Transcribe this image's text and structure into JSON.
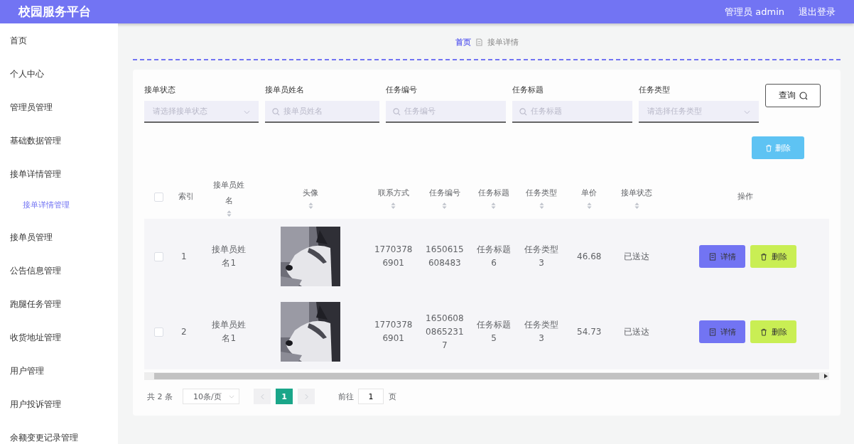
{
  "header": {
    "title": "校园服务平台",
    "user": "管理员 admin",
    "logout": "退出登录"
  },
  "sidebar": {
    "items": [
      {
        "label": "首页",
        "selected": false
      },
      {
        "label": "个人中心",
        "selected": false
      },
      {
        "label": "管理员管理",
        "selected": false
      },
      {
        "label": "基础数据管理",
        "selected": false
      },
      {
        "label": "接单详情管理",
        "selected": false,
        "children": [
          {
            "label": "接单详情管理",
            "selected": true
          }
        ]
      },
      {
        "label": "接单员管理",
        "selected": false
      },
      {
        "label": "公告信息管理",
        "selected": false
      },
      {
        "label": "跑腿任务管理",
        "selected": false
      },
      {
        "label": "收货地址管理",
        "selected": false
      },
      {
        "label": "用户管理",
        "selected": false
      },
      {
        "label": "用户投诉管理",
        "selected": false
      },
      {
        "label": "余额变更记录管理",
        "selected": false
      }
    ]
  },
  "breadcrumb": [
    {
      "label": "首页",
      "kind": "link"
    },
    {
      "label": "接单详情",
      "kind": "current"
    }
  ],
  "filters": [
    {
      "label": "接单状态",
      "kind": "select",
      "placeholder": "请选择接单状态"
    },
    {
      "label": "接单员姓名",
      "kind": "text",
      "placeholder": "接单员姓名"
    },
    {
      "label": "任务编号",
      "kind": "text",
      "placeholder": "任务编号"
    },
    {
      "label": "任务标题",
      "kind": "text",
      "placeholder": "任务标题"
    },
    {
      "label": "任务类型",
      "kind": "select",
      "placeholder": "请选择任务类型"
    }
  ],
  "query_button": "查询",
  "delete_button": "删除",
  "table": {
    "all_selected": false,
    "columns": [
      {
        "label": "索引",
        "sortable": false
      },
      {
        "label": "接单员姓名",
        "sortable": true
      },
      {
        "label": "头像",
        "sortable": true
      },
      {
        "label": "联系方式",
        "sortable": true
      },
      {
        "label": "任务编号",
        "sortable": true
      },
      {
        "label": "任务标题",
        "sortable": true
      },
      {
        "label": "任务类型",
        "sortable": true
      },
      {
        "label": "单价",
        "sortable": true
      },
      {
        "label": "接单状态",
        "sortable": true
      },
      {
        "label": "操作",
        "sortable": false
      }
    ],
    "rows": [
      {
        "selected": false,
        "cells": [
          "1",
          "接单员姓名1",
          {
            "kind": "picture"
          },
          "17703786901",
          "1650615608483",
          "任务标题6",
          "任务类型3",
          "46.68",
          "已送达"
        ],
        "actions": [
          {
            "label": "详情",
            "kind": "detail"
          },
          {
            "label": "删除",
            "kind": "delete"
          }
        ]
      },
      {
        "selected": false,
        "cells": [
          "2",
          "接单员姓名1",
          {
            "kind": "picture"
          },
          "17703786901",
          "165060808652317",
          "任务标题5",
          "任务类型3",
          "54.73",
          "已送达"
        ],
        "actions": [
          {
            "label": "详情",
            "kind": "detail"
          },
          {
            "label": "删除",
            "kind": "delete"
          }
        ]
      }
    ]
  },
  "pagination": {
    "total": "共 2 条",
    "page_size": "10条/页",
    "pages": [
      {
        "label": "1",
        "selected": true
      }
    ],
    "goto_label": "前往",
    "goto_value": "1",
    "page_suffix": "页"
  }
}
